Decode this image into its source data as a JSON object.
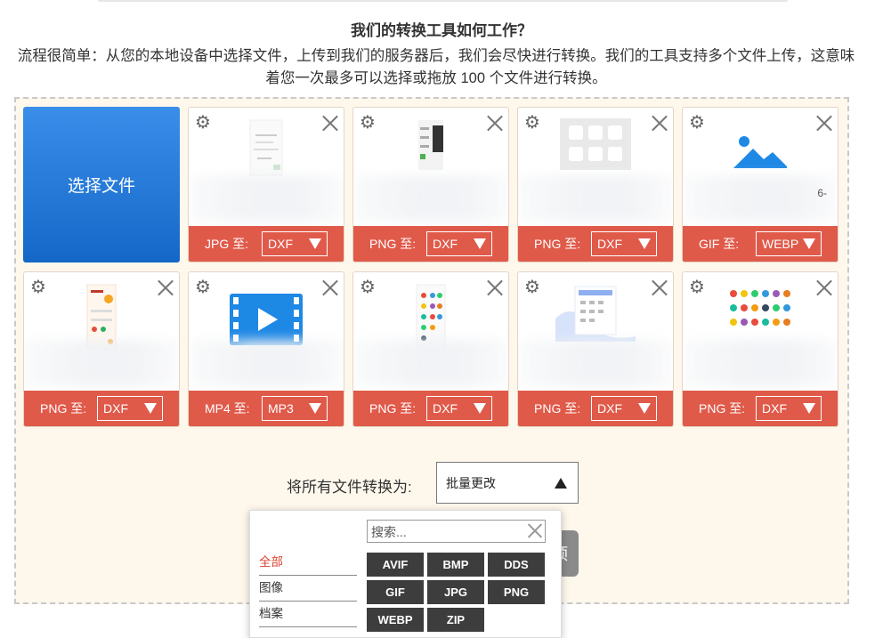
{
  "heading": "我们的转换工具如何工作？",
  "description": "流程很简单：从您的本地设备中选择文件，上传到我们的服务器后，我们会尽快进行转换。我们的工具支持多个文件上传，这意味着您一次最多可以选择或拖放 100 个文件进行转换。",
  "choose_button": "选择文件",
  "cards": [
    {
      "from": "JPG 至:",
      "to": "DXF",
      "thumb": "screenshot",
      "note": ""
    },
    {
      "from": "PNG 至:",
      "to": "DXF",
      "thumb": "phone",
      "note": ""
    },
    {
      "from": "PNG 至:",
      "to": "DXF",
      "thumb": "icons",
      "note": ""
    },
    {
      "from": "GIF 至:",
      "to": "WEBP",
      "thumb": "image-icon",
      "note": "6-"
    },
    {
      "from": "PNG 至:",
      "to": "DXF",
      "thumb": "app",
      "note": ""
    },
    {
      "from": "MP4 至:",
      "to": "MP3",
      "thumb": "video-icon",
      "note": ""
    },
    {
      "from": "PNG 至:",
      "to": "DXF",
      "thumb": "phone-list",
      "note": ""
    },
    {
      "from": "PNG 至:",
      "to": "DXF",
      "thumb": "calendar",
      "note": ""
    },
    {
      "from": "PNG 至:",
      "to": "DXF",
      "thumb": "grid",
      "note": ""
    }
  ],
  "convert_all": {
    "label": "将所有文件转换为:",
    "select_value": "批量更改"
  },
  "convert_button": "顶",
  "dropdown": {
    "categories": [
      "全部",
      "图像",
      "档案"
    ],
    "search_placeholder": "搜索...",
    "formats": [
      "AVIF",
      "BMP",
      "DDS",
      "GIF",
      "JPG",
      "PNG",
      "WEBP",
      "ZIP"
    ]
  }
}
